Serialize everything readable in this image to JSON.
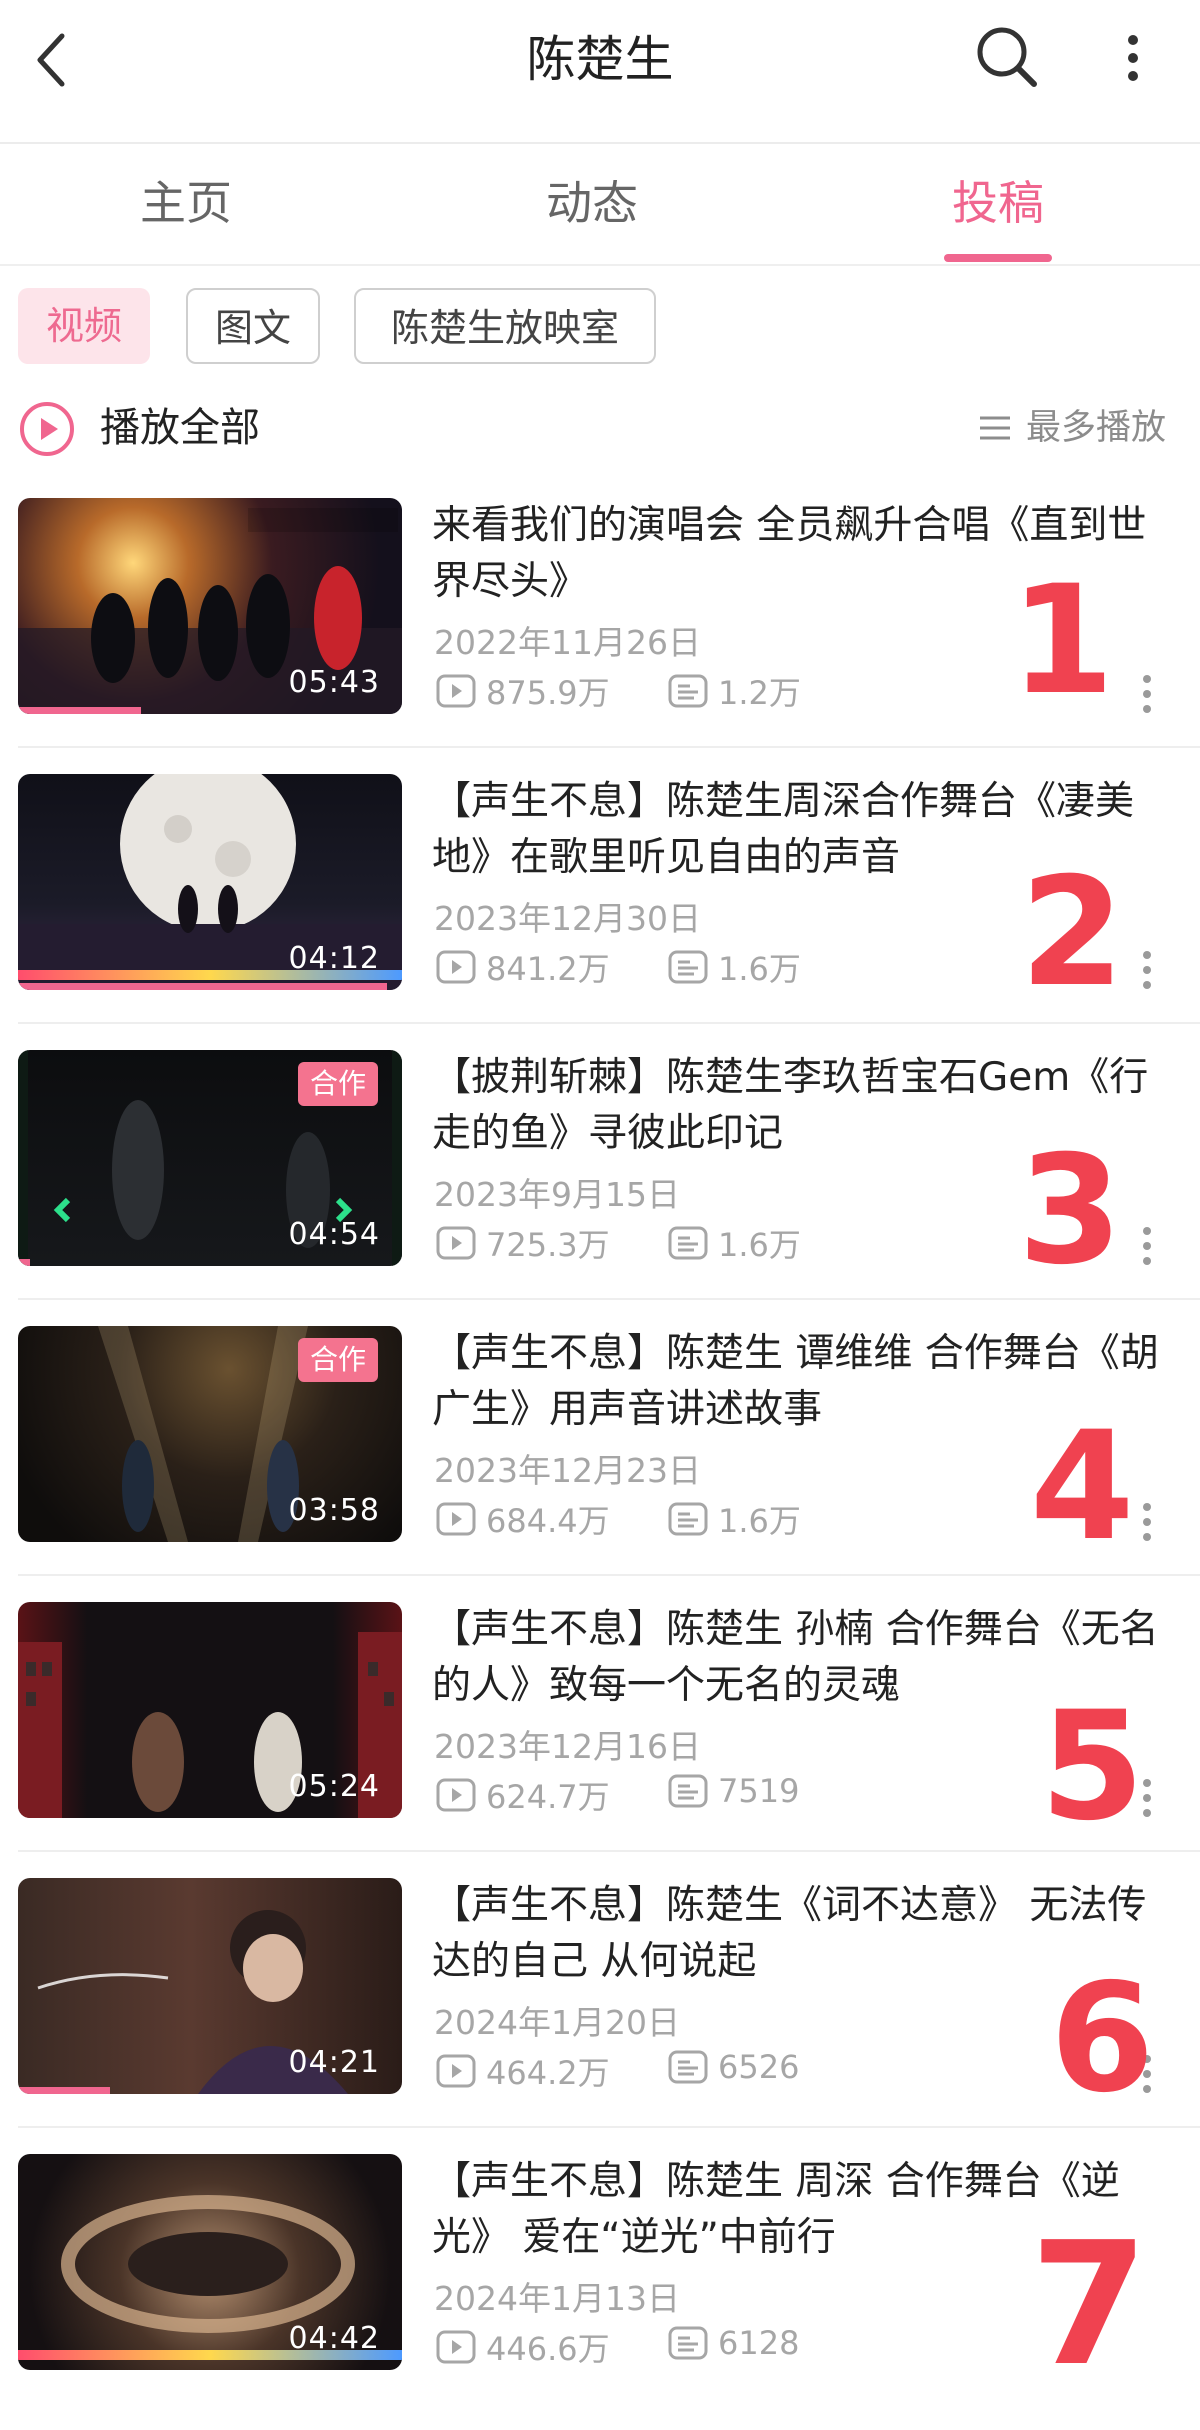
{
  "header": {
    "title": "陈楚生",
    "back_icon": "chevron-left-icon",
    "search_icon": "search-icon",
    "more_icon": "more-vertical-icon"
  },
  "tabs": [
    {
      "label": "主页",
      "active": false
    },
    {
      "label": "动态",
      "active": false
    },
    {
      "label": "投稿",
      "active": true
    }
  ],
  "filters": [
    {
      "label": "视频",
      "active": true
    },
    {
      "label": "图文",
      "active": false
    },
    {
      "label": "陈楚生放映室",
      "active": false
    }
  ],
  "play_all": {
    "label": "播放全部",
    "icon": "play-circle-icon"
  },
  "sort": {
    "label": "最多播放",
    "icon": "sort-lines-icon"
  },
  "accent_color": "#f0668f",
  "rank_color": "#f04250",
  "videos": [
    {
      "title": "来看我们的演唱会 全员飙升合唱《直到世界尽头》",
      "date": "2022年11月26日",
      "plays": "875.9万",
      "comments": "1.2万",
      "duration": "05:43",
      "badge": "",
      "rank": "1",
      "watched": 0.32
    },
    {
      "title": "【声生不息】陈楚生周深合作舞台《凄美地》在歌里听见自由的声音",
      "date": "2023年12月30日",
      "plays": "841.2万",
      "comments": "1.6万",
      "duration": "04:12",
      "badge": "",
      "rank": "2",
      "watched": 0.96
    },
    {
      "title": "【披荆斩棘】陈楚生李玖哲宝石Gem《行走的鱼》寻彼此印记",
      "date": "2023年9月15日",
      "plays": "725.3万",
      "comments": "1.6万",
      "duration": "04:54",
      "badge": "合作",
      "rank": "3",
      "watched": 0.03
    },
    {
      "title": "【声生不息】陈楚生 谭维维 合作舞台《胡广生》用声音讲述故事",
      "date": "2023年12月23日",
      "plays": "684.4万",
      "comments": "1.6万",
      "duration": "03:58",
      "badge": "合作",
      "rank": "4",
      "watched": 0
    },
    {
      "title": "【声生不息】陈楚生 孙楠 合作舞台《无名的人》致每一个无名的灵魂",
      "date": "2023年12月16日",
      "plays": "624.7万",
      "comments": "7519",
      "duration": "05:24",
      "badge": "",
      "rank": "5",
      "watched": 0
    },
    {
      "title": "【声生不息】陈楚生《词不达意》 无法传达的自己 从何说起",
      "date": "2024年1月20日",
      "plays": "464.2万",
      "comments": "6526",
      "duration": "04:21",
      "badge": "",
      "rank": "6",
      "watched": 0.24
    },
    {
      "title": "【声生不息】陈楚生 周深 合作舞台《逆光》 爱在“逆光”中前行",
      "date": "2024年1月13日",
      "plays": "446.6万",
      "comments": "6128",
      "duration": "04:42",
      "badge": "",
      "rank": "7",
      "watched": 0
    }
  ]
}
